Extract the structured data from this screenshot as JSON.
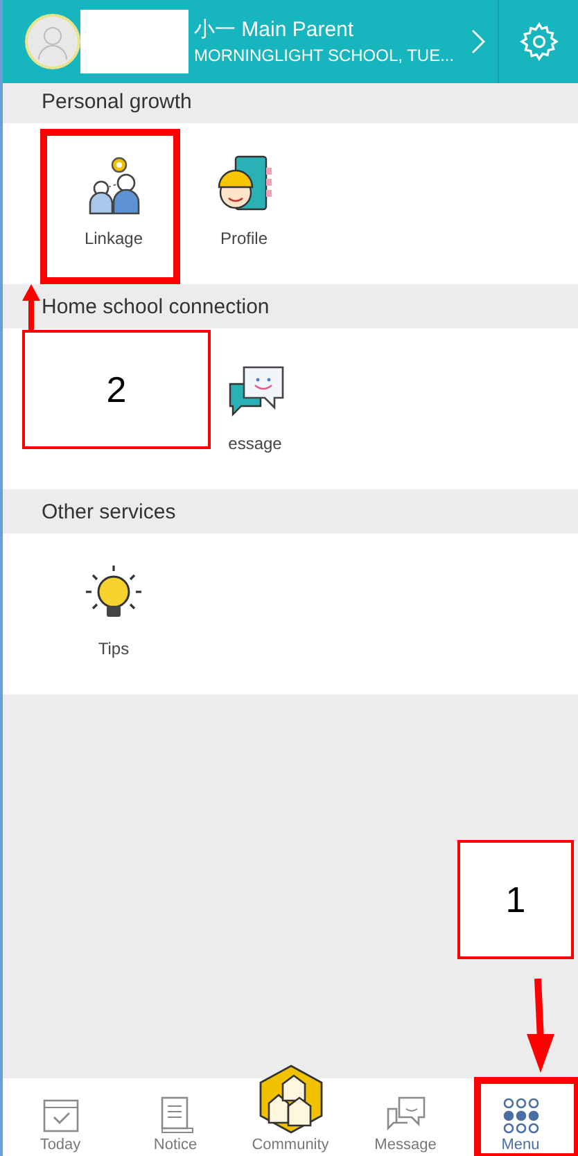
{
  "header": {
    "name": "小一 Main Parent",
    "school": "MORNINGLIGHT SCHOOL, TUE...",
    "redacted": true
  },
  "sections": [
    {
      "title": "Personal growth",
      "items": [
        {
          "kind": "linkage",
          "label": "Linkage"
        },
        {
          "kind": "profile",
          "label": "Profile"
        }
      ]
    },
    {
      "title": "Home school connection",
      "items": [
        {
          "kind": "covered"
        },
        {
          "kind": "message",
          "label": "essage"
        }
      ]
    },
    {
      "title": "Other services",
      "items": [
        {
          "kind": "tips",
          "label": "Tips"
        }
      ]
    }
  ],
  "bottom_nav": [
    {
      "kind": "today",
      "label": "Today",
      "selected": false
    },
    {
      "kind": "notice",
      "label": "Notice",
      "selected": false
    },
    {
      "kind": "community",
      "label": "Community",
      "selected": false
    },
    {
      "kind": "message",
      "label": "Message",
      "selected": false
    },
    {
      "kind": "menu",
      "label": "Menu",
      "selected": true
    }
  ],
  "annotations": [
    {
      "label": "2",
      "kind": "upper"
    },
    {
      "label": "1",
      "kind": "lower"
    }
  ]
}
